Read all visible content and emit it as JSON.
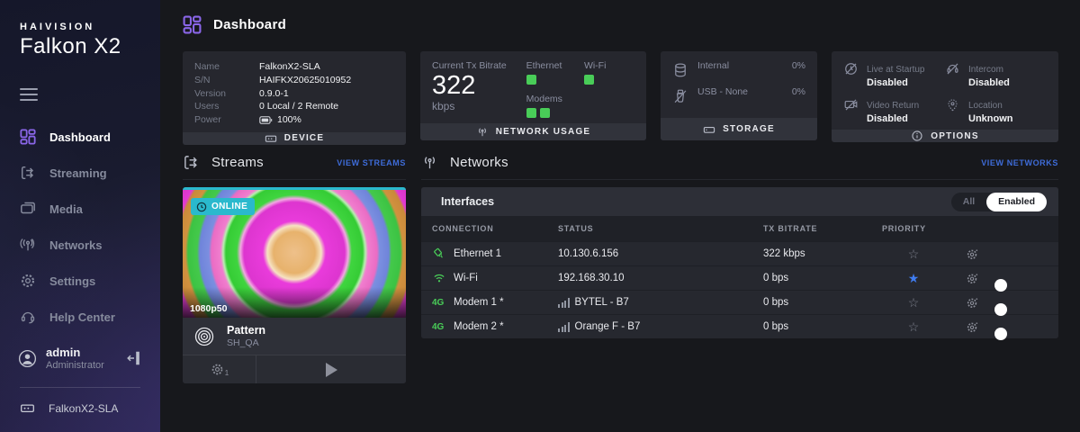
{
  "brand": {
    "company": "HAIVISION",
    "product": "Falkon X2"
  },
  "sidebar": {
    "items": [
      {
        "label": "Dashboard"
      },
      {
        "label": "Streaming"
      },
      {
        "label": "Media"
      },
      {
        "label": "Networks"
      },
      {
        "label": "Settings"
      },
      {
        "label": "Help Center"
      }
    ],
    "user": {
      "name": "admin",
      "role": "Administrator"
    },
    "device_label": "FalkonX2-SLA"
  },
  "header": {
    "title": "Dashboard"
  },
  "device_card": {
    "rows": [
      {
        "label": "Name",
        "value": "FalkonX2-SLA"
      },
      {
        "label": "S/N",
        "value": "HAIFKX20625010952"
      },
      {
        "label": "Version",
        "value": "0.9.0-1"
      },
      {
        "label": "Users",
        "value": "0 Local / 2 Remote"
      }
    ],
    "power_label": "Power",
    "power_value": "100%",
    "footer": "DEVICE"
  },
  "network_usage_card": {
    "bitrate_label": "Current Tx Bitrate",
    "bitrate_value": "322",
    "bitrate_unit": "kbps",
    "ethernet_label": "Ethernet",
    "wifi_label": "Wi-Fi",
    "modems_label": "Modems",
    "footer": "NETWORK USAGE"
  },
  "storage_card": {
    "items": [
      {
        "label": "Internal",
        "percent": "0%"
      },
      {
        "label": "USB - None",
        "percent": "0%"
      }
    ],
    "footer": "STORAGE"
  },
  "options_card": {
    "items": [
      {
        "label": "Live at Startup",
        "value": "Disabled"
      },
      {
        "label": "Intercom",
        "value": "Disabled"
      },
      {
        "label": "Video Return",
        "value": "Disabled"
      },
      {
        "label": "Location",
        "value": "Unknown"
      }
    ],
    "footer": "OPTIONS"
  },
  "streams": {
    "title": "Streams",
    "view_link": "VIEW STREAMS",
    "stream": {
      "status": "ONLINE",
      "resolution": "1080p50",
      "name": "Pattern",
      "subtitle": "SH_QA",
      "settings_badge": "1"
    }
  },
  "networks": {
    "title": "Networks",
    "view_link": "VIEW NETWORKS",
    "panel": {
      "title": "Interfaces",
      "filter": {
        "all": "All",
        "enabled": "Enabled",
        "selected": "Enabled"
      },
      "columns": [
        "CONNECTION",
        "STATUS",
        "TX BITRATE",
        "PRIORITY"
      ],
      "rows": [
        {
          "name": "Ethernet 1",
          "status": "10.130.6.156",
          "tx": "322 kbps",
          "star": "☆",
          "starred": false,
          "enabled_toggle": null
        },
        {
          "name": "Wi-Fi",
          "status": "192.168.30.10",
          "tx": "0 bps",
          "star": "★",
          "starred": true,
          "enabled_toggle": true
        },
        {
          "name": "Modem 1 *",
          "badge": "4G",
          "status": "BYTEL - B7",
          "tx": "0 bps",
          "star": "☆",
          "starred": false,
          "enabled_toggle": true
        },
        {
          "name": "Modem 2 *",
          "badge": "4G",
          "status": "Orange F - B7",
          "tx": "0 bps",
          "star": "☆",
          "starred": false,
          "enabled_toggle": true
        }
      ]
    }
  },
  "colors": {
    "accent_purple": "#8a66e8",
    "link_blue": "#3e6cd9",
    "green": "#49cd58",
    "cyan": "#2ab9cd",
    "toggle_blue": "#2e7bf6",
    "star_blue": "#3f7cf0"
  }
}
